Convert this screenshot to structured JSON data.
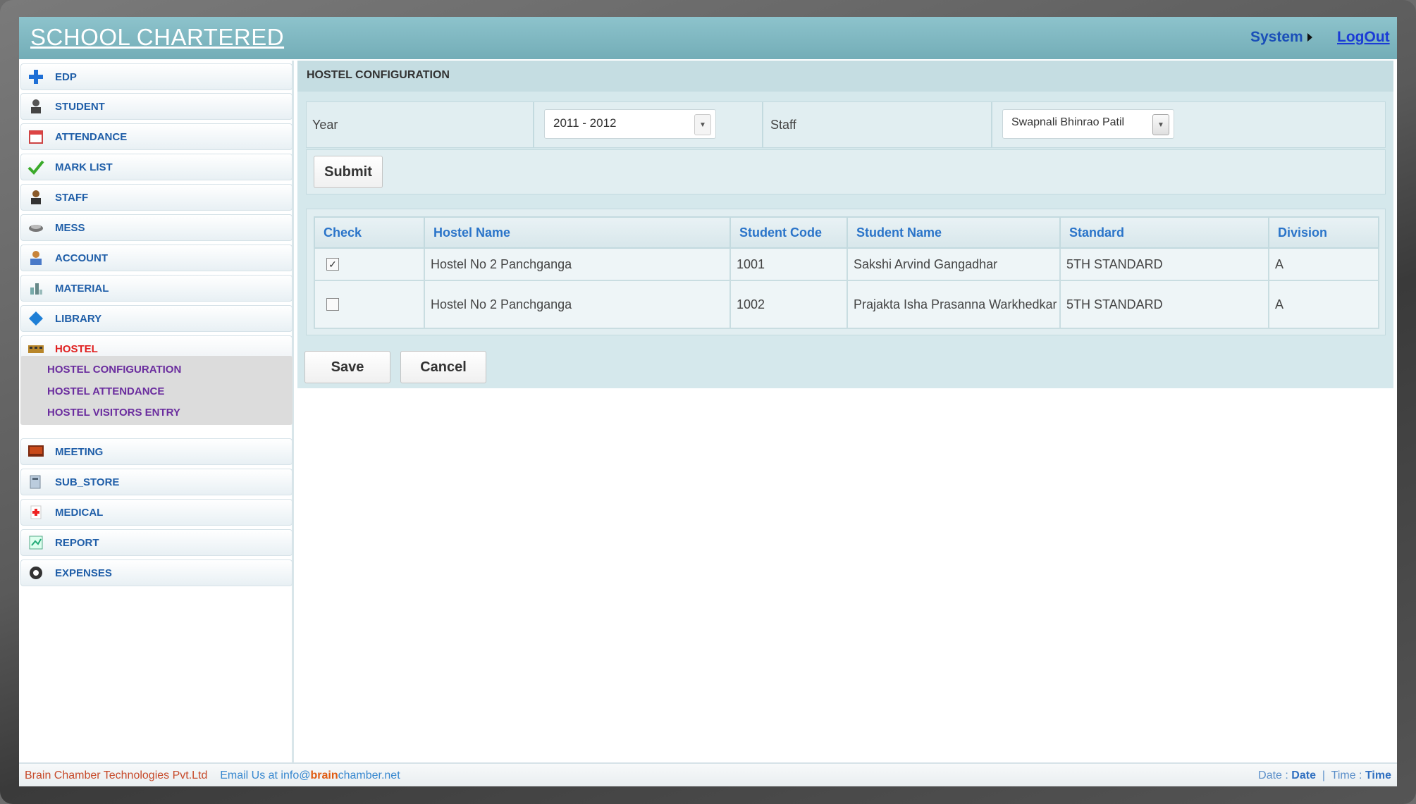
{
  "app": {
    "brand": "SCHOOL CHARTERED",
    "system_label": "System",
    "logout_label": "LogOut"
  },
  "sidebar": {
    "items": [
      {
        "label": "EDP",
        "icon": "plus-icon"
      },
      {
        "label": "STUDENT",
        "icon": "student-icon"
      },
      {
        "label": "ATTENDANCE",
        "icon": "calendar-icon"
      },
      {
        "label": "MARK LIST",
        "icon": "check-icon"
      },
      {
        "label": "STAFF",
        "icon": "staff-icon"
      },
      {
        "label": "MESS",
        "icon": "mess-icon"
      },
      {
        "label": "ACCOUNT",
        "icon": "account-icon"
      },
      {
        "label": "MATERIAL",
        "icon": "material-icon"
      },
      {
        "label": "LIBRARY",
        "icon": "library-icon"
      },
      {
        "label": "HOSTEL",
        "icon": "hostel-icon"
      },
      {
        "label": "MEETING",
        "icon": "meeting-icon"
      },
      {
        "label": "SUB_STORE",
        "icon": "store-icon"
      },
      {
        "label": "MEDICAL",
        "icon": "medical-icon"
      },
      {
        "label": "REPORT",
        "icon": "report-icon"
      },
      {
        "label": "EXPENSES",
        "icon": "expenses-icon"
      }
    ],
    "submenu": [
      "HOSTEL CONFIGURATION",
      "HOSTEL ATTENDANCE",
      "HOSTEL VISITORS ENTRY"
    ]
  },
  "main": {
    "title": "HOSTEL CONFIGURATION",
    "form": {
      "year_label": "Year",
      "year_value": "2011 - 2012",
      "staff_label": "Staff",
      "staff_value": "Swapnali Bhinrao Patil",
      "submit_label": "Submit"
    },
    "table": {
      "headers": [
        "Check",
        "Hostel Name",
        "Student Code",
        "Student Name",
        "Standard",
        "Division"
      ],
      "rows": [
        {
          "checked": true,
          "hostel": "Hostel No 2 Panchganga",
          "code": "1001",
          "name": "Sakshi Arvind Gangadhar",
          "standard": "5TH STANDARD",
          "division": "A"
        },
        {
          "checked": false,
          "hostel": "Hostel No 2 Panchganga",
          "code": "1002",
          "name": "Prajakta Isha Prasanna Warkhedkar",
          "standard": "5TH STANDARD",
          "division": "A"
        }
      ]
    },
    "save_label": "Save",
    "cancel_label": "Cancel"
  },
  "footer": {
    "company": "Brain Chamber Technologies Pvt.Ltd",
    "email_prefix": "Email Us at info@",
    "email_highlight": "brain",
    "email_suffix": "chamber.net",
    "date_label": "Date : ",
    "date_value": "Date",
    "time_label": "Time : ",
    "time_value": "Time"
  },
  "colors": {
    "header_bg": "#7fb8c2",
    "nav_text": "#1f5ea8",
    "active_nav": "#e02020",
    "submenu_text": "#6a2c9e",
    "table_header_text": "#2a74c9"
  }
}
